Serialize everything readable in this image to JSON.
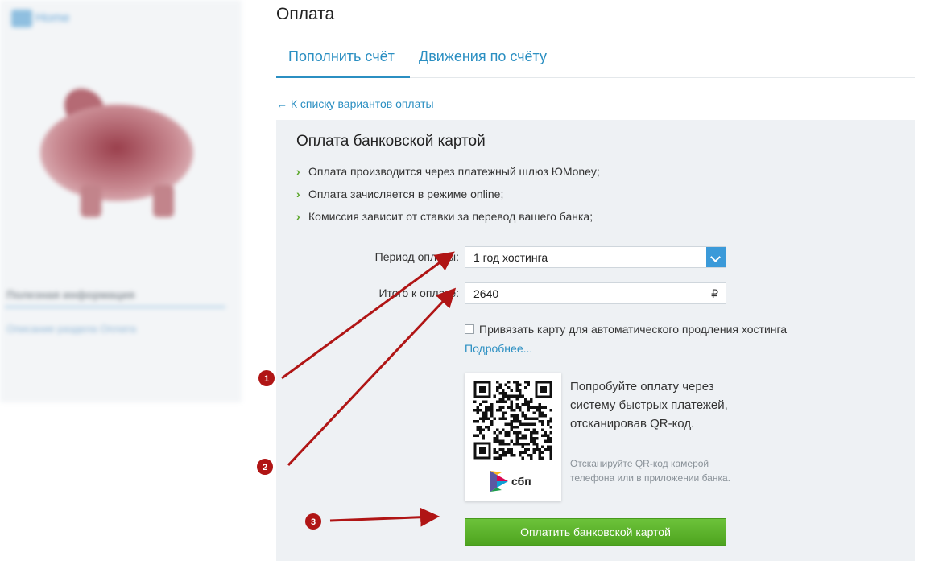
{
  "sidebar": {
    "logo_text": "Home",
    "useful_heading": "Полезная информация",
    "useful_link": "Описание раздела Оплата"
  },
  "page": {
    "title": "Оплата",
    "tabs": [
      {
        "label": "Пополнить счёт",
        "active": true
      },
      {
        "label": "Движения по счёту",
        "active": false
      }
    ],
    "back_link": "← К списку вариантов оплаты"
  },
  "panel": {
    "title": "Оплата банковской картой",
    "bullets": [
      "Оплата производится через платежный шлюз ЮMoney;",
      "Оплата зачисляется в режиме online;",
      "Комиссия зависит от ставки за перевод вашего банка;"
    ],
    "period_label": "Период оплаты:",
    "period_value": "1 год хостинга",
    "total_label": "Итого к оплате:",
    "total_value": "2640",
    "currency": "₽",
    "autorenew_label": "Привязать карту для автоматического продления хостинга",
    "autorenew_checked": false,
    "more_link": "Подробнее...",
    "qr_title": "Попробуйте оплату через систему быстрых платежей, отсканировав QR-код.",
    "qr_hint": "Отсканируйте QR-код камерой телефона или в приложении банка.",
    "sbp_label": "сбп",
    "pay_button": "Оплатить банковской картой"
  },
  "annotations": {
    "markers": [
      "1",
      "2",
      "3"
    ],
    "color": "#b01515"
  },
  "colors": {
    "link": "#2b8fc2",
    "pay_button": "#56ae24",
    "panel_bg": "#eef1f4"
  }
}
